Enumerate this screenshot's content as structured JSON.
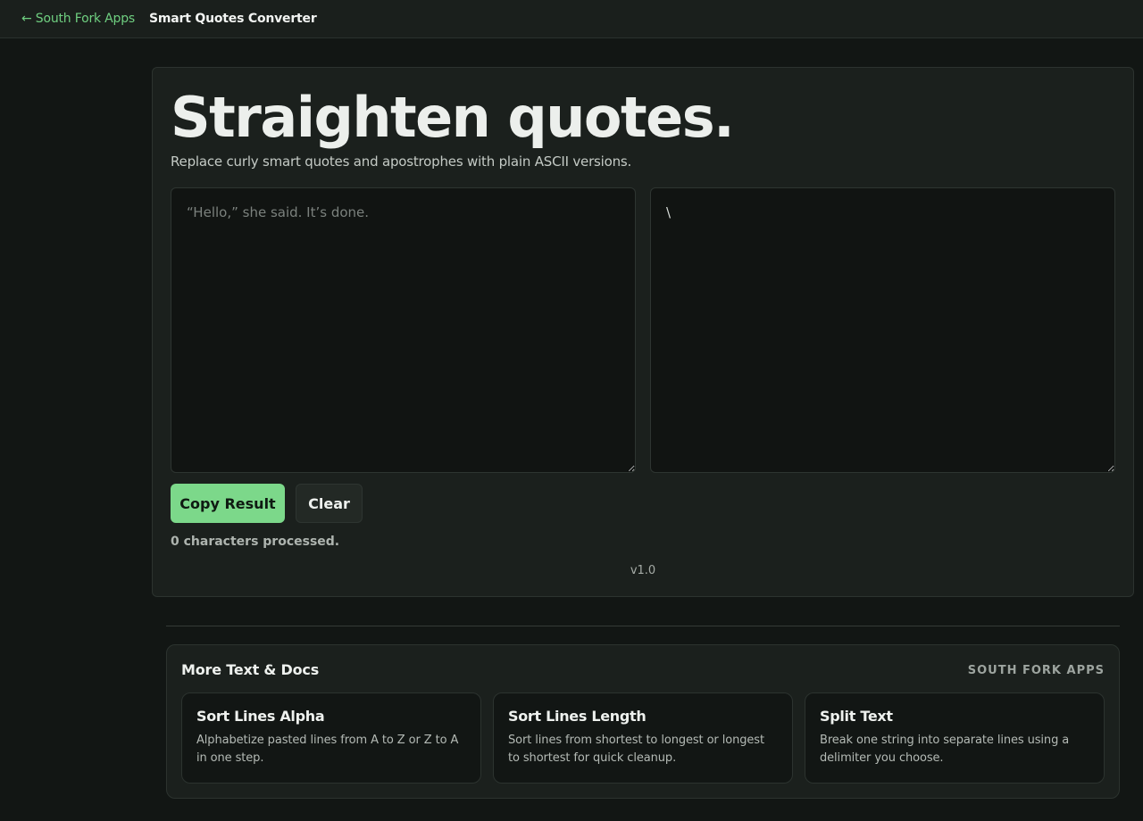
{
  "topbar": {
    "back_label": "← South Fork Apps",
    "tool_title": "Smart Quotes Converter"
  },
  "converter": {
    "headline": "Straighten quotes.",
    "subtitle": "Replace curly smart quotes and apostrophes with plain ASCII versions.",
    "input_placeholder": "“Hello,” she said. It’s done.",
    "input_value": "",
    "output_value": "\\",
    "copy_label": "Copy Result",
    "clear_label": "Clear",
    "status": "0 characters processed.",
    "version": "v1.0"
  },
  "more": {
    "title": "More Text & Docs",
    "brand": "SOUTH FORK APPS",
    "apps": [
      {
        "title": "Sort Lines Alpha",
        "desc": "Alphabetize pasted lines from A to Z or Z to A in one step."
      },
      {
        "title": "Sort Lines Length",
        "desc": "Sort lines from shortest to longest or longest to shortest for quick cleanup."
      },
      {
        "title": "Split Text",
        "desc": "Break one string into separate lines using a delimiter you choose."
      }
    ]
  },
  "colors": {
    "accent": "#7cd88a",
    "background": "#121614",
    "card": "#1b201d"
  }
}
